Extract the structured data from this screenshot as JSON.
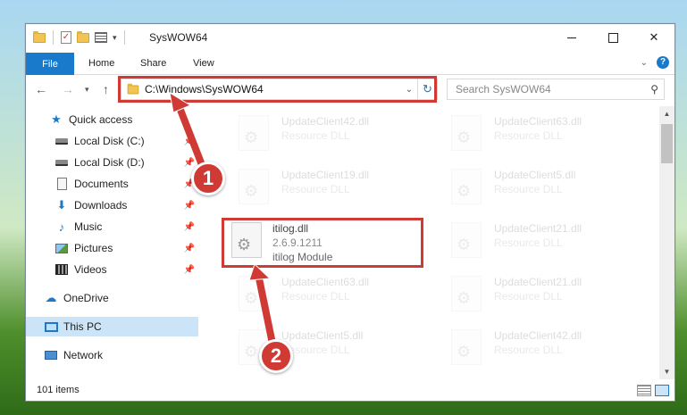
{
  "window": {
    "title": "SysWOW64"
  },
  "ribbon": {
    "tabs": [
      "File",
      "Home",
      "Share",
      "View"
    ]
  },
  "address": {
    "path": "C:\\Windows\\SysWOW64"
  },
  "search": {
    "placeholder": "Search SysWOW64"
  },
  "nav": {
    "items": [
      {
        "label": "Quick access",
        "icon": "star-icon"
      },
      {
        "label": "Local Disk (C:)",
        "icon": "drive-icon"
      },
      {
        "label": "Local Disk (D:)",
        "icon": "drive-icon"
      },
      {
        "label": "Documents",
        "icon": "document-icon"
      },
      {
        "label": "Downloads",
        "icon": "download-icon"
      },
      {
        "label": "Music",
        "icon": "music-icon"
      },
      {
        "label": "Pictures",
        "icon": "pictures-icon"
      },
      {
        "label": "Videos",
        "icon": "videos-icon"
      },
      {
        "label": "OneDrive",
        "icon": "cloud-icon"
      },
      {
        "label": "This PC",
        "icon": "computer-icon"
      },
      {
        "label": "Network",
        "icon": "network-icon"
      }
    ]
  },
  "files": [
    {
      "name": "UpdateClient42.dll",
      "desc": "Resource DLL"
    },
    {
      "name": "UpdateClient63.dll",
      "desc": "Resource DLL"
    },
    {
      "name": "UpdateClient19.dll",
      "desc": "Resource DLL"
    },
    {
      "name": "UpdateClient5.dll",
      "desc": "Resource DLL"
    },
    {
      "name": "itilog.dll",
      "desc": "2.6.9.1211",
      "desc2": "itilog Module"
    },
    {
      "name": "UpdateClient21.dll",
      "desc": "Resource DLL"
    },
    {
      "name": "UpdateClient63.dll",
      "desc": "Resource DLL"
    },
    {
      "name": "UpdateClient21.dll",
      "desc": "Resource DLL"
    },
    {
      "name": "UpdateClient5.dll",
      "desc": "Resource DLL"
    },
    {
      "name": "UpdateClient42.dll",
      "desc": "Resource DLL"
    }
  ],
  "status": {
    "count": "101 items"
  },
  "callouts": {
    "one": "1",
    "two": "2"
  },
  "colors": {
    "accent": "#1979ca",
    "highlight": "#d03a35"
  }
}
